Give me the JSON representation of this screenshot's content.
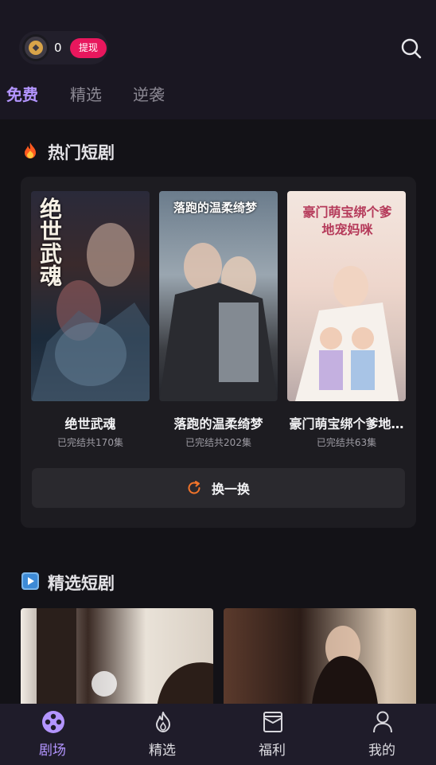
{
  "header": {
    "coin_count": "0",
    "withdraw_label": "提现",
    "tabs": [
      {
        "label": "免费",
        "active": true
      },
      {
        "label": "精选",
        "active": false
      },
      {
        "label": "逆袭",
        "active": false
      }
    ]
  },
  "hot_section": {
    "title": "热门短剧",
    "icon": "fire-icon",
    "dramas": [
      {
        "title": "绝世武魂",
        "status": "已完结共170集",
        "poster_text": "绝世武魂"
      },
      {
        "title": "落跑的温柔绮梦",
        "status": "已完结共202集",
        "poster_text": "落跑的温柔绮梦"
      },
      {
        "title": "豪门萌宝绑个爹地…",
        "status": "已完结共63集",
        "poster_text": "豪门萌宝绑个爹地宠妈咪"
      }
    ],
    "refresh_label": "换一换"
  },
  "featured_section": {
    "title": "精选短剧",
    "icon": "play-icon"
  },
  "bottom_nav": {
    "items": [
      {
        "label": "剧场",
        "icon": "film-reel-icon",
        "active": true
      },
      {
        "label": "精选",
        "icon": "flame-icon",
        "active": false
      },
      {
        "label": "福利",
        "icon": "gift-envelope-icon",
        "active": false
      },
      {
        "label": "我的",
        "icon": "user-icon",
        "active": false
      }
    ]
  },
  "colors": {
    "accent": "#b395ff",
    "withdraw": "#e8175d",
    "refresh_icon": "#f0732a",
    "coin": "#d9a449"
  }
}
